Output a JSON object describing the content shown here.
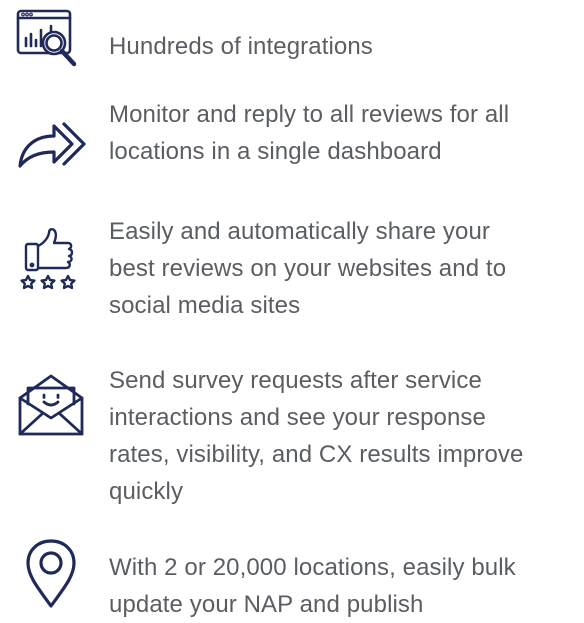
{
  "brand_color": "#1f2a5a",
  "text_color": "#5a5e63",
  "features": [
    {
      "icon": "integrations-dashboard-icon",
      "text": "Hundreds of integrations"
    },
    {
      "icon": "reply-arrow-icon",
      "text": "Monitor and reply to all reviews for all\nlocations in a single dashboard"
    },
    {
      "icon": "thumbs-up-stars-icon",
      "text": "Easily and automatically share your\nbest reviews on your websites and to\nsocial media sites"
    },
    {
      "icon": "survey-envelope-icon",
      "text": "Send survey requests after service\ninteractions and see your response\nrates, visibility, and CX results improve\nquickly"
    },
    {
      "icon": "location-pin-icon",
      "text": "With 2 or 20,000 locations, easily bulk\nupdate your NAP and publish"
    }
  ]
}
